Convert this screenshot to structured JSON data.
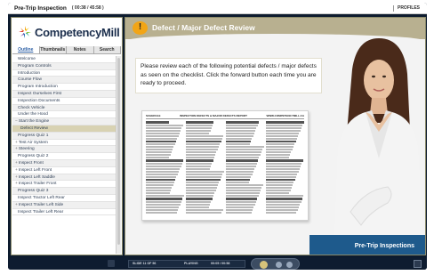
{
  "titlebar": {
    "course": "Pre-Trip Inspection",
    "timer": "( 00:38 / 45:58 )",
    "profiles": "PROFILES"
  },
  "brand": {
    "name": "CompetencyMill"
  },
  "tabs": [
    {
      "label": "Outline",
      "active": true
    },
    {
      "label": "Thumbnails",
      "active": false
    },
    {
      "label": "Notes",
      "active": false
    },
    {
      "label": "Search",
      "active": false
    }
  ],
  "outline": [
    {
      "label": "Welcome",
      "type": "item"
    },
    {
      "label": "Program Controls",
      "type": "item"
    },
    {
      "label": "Introduction",
      "type": "item"
    },
    {
      "label": "Course Flow",
      "type": "item"
    },
    {
      "label": "Program Introduction",
      "type": "item"
    },
    {
      "label": "Inspect Ourselves First",
      "type": "item"
    },
    {
      "label": "Inspection Documents",
      "type": "item"
    },
    {
      "label": "Check Vehicle",
      "type": "item"
    },
    {
      "label": "Under the Hood",
      "type": "item"
    },
    {
      "label": "Start the Engine",
      "type": "expanded"
    },
    {
      "label": "Defect Review",
      "type": "current"
    },
    {
      "label": "Progress Quiz 1",
      "type": "item"
    },
    {
      "label": "Test Air System",
      "type": "collapsed"
    },
    {
      "label": "Steering",
      "type": "collapsed"
    },
    {
      "label": "Progress Quiz 2",
      "type": "item"
    },
    {
      "label": "Inspect Front",
      "type": "collapsed"
    },
    {
      "label": "Inspect Left Front",
      "type": "collapsed"
    },
    {
      "label": "Inspect Left Saddle",
      "type": "collapsed"
    },
    {
      "label": "Inspect Trailer Front",
      "type": "collapsed"
    },
    {
      "label": "Progress Quiz 3",
      "type": "item"
    },
    {
      "label": "Inspect Tractor Left Rear",
      "type": "item"
    },
    {
      "label": "Inspect Trailer Left Side",
      "type": "collapsed"
    },
    {
      "label": "Inspect Trailer Left Rear",
      "type": "item"
    }
  ],
  "slide": {
    "title": "Defect / Major Defect Review",
    "instructions": "Please review each of the following potential defects / major defects as seen on the checklist. Click the forward button each time you are ready to proceed.",
    "banner": "Pre-Trip Inspections",
    "doc": {
      "left": "SCHEDULE",
      "center": "INSPECTION DEFECTS & MAJOR DEFECTS REPORT",
      "right": "WWW.COMPETENCYMILL.CA"
    }
  },
  "player": {
    "slide_counter": "SLIDE 11 OF 56",
    "status": "PLAYING",
    "time": "00:05 / 00:58"
  },
  "colors": {
    "header_band": "#b8b090",
    "warning": "#f2a516",
    "banner_blue": "#1e5a8c",
    "current_item": "#d8d2b2",
    "brand_navy": "#1c2f4d"
  }
}
